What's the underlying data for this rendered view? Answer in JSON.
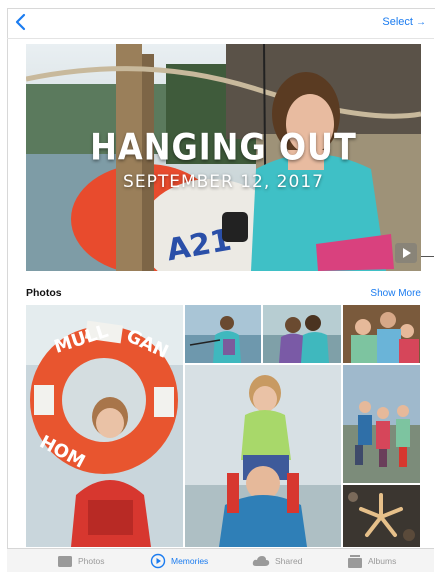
{
  "navbar": {
    "select_label": "Select"
  },
  "memory": {
    "title": "HANGING OUT",
    "date": "SEPTEMBER 12, 2017"
  },
  "photos_section": {
    "title": "Photos",
    "show_more": "Show More"
  },
  "tabbar": {
    "tabs": [
      {
        "label": "Photos",
        "icon": "photos-icon",
        "active": false
      },
      {
        "label": "Memories",
        "icon": "memories-icon",
        "active": true
      },
      {
        "label": "Shared",
        "icon": "cloud-icon",
        "active": false
      },
      {
        "label": "Albums",
        "icon": "albums-icon",
        "active": false
      }
    ]
  },
  "colors": {
    "accent": "#1b7cf0",
    "tab_inactive": "#9a9a9a",
    "tabbar_bg": "#f4f4f4"
  }
}
